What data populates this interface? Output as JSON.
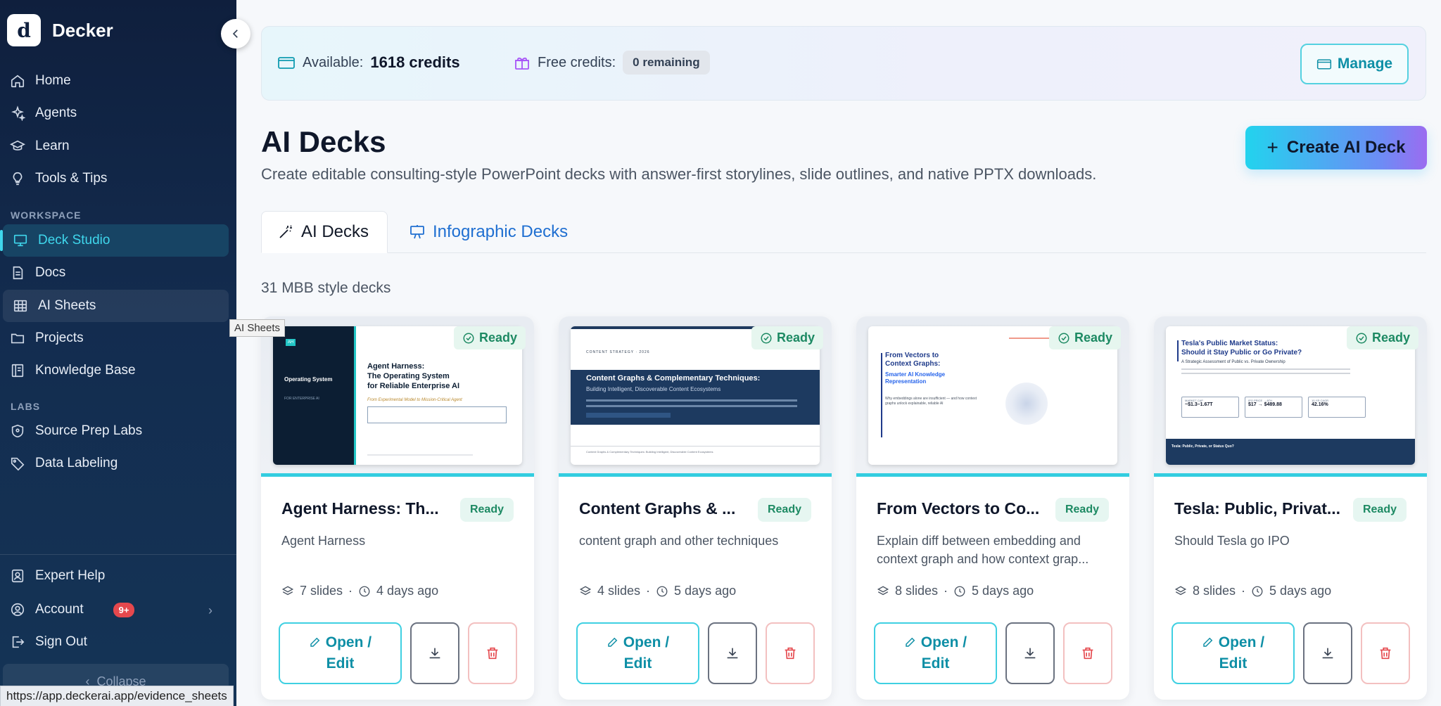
{
  "app": {
    "name": "Decker",
    "logo_letter": "d"
  },
  "sidebar": {
    "nav": [
      {
        "label": "Home",
        "icon": "home-icon"
      },
      {
        "label": "Agents",
        "icon": "sparkles-icon"
      },
      {
        "label": "Learn",
        "icon": "graduation-cap-icon"
      },
      {
        "label": "Tools & Tips",
        "icon": "lightbulb-icon"
      }
    ],
    "workspace_label": "WORKSPACE",
    "workspace": [
      {
        "label": "Deck Studio",
        "icon": "presentation-icon",
        "active": true
      },
      {
        "label": "Docs",
        "icon": "document-icon"
      },
      {
        "label": "AI Sheets",
        "icon": "table-icon",
        "hovered": true
      },
      {
        "label": "Projects",
        "icon": "folder-icon"
      },
      {
        "label": "Knowledge Base",
        "icon": "book-icon"
      }
    ],
    "labs_label": "LABS",
    "labs": [
      {
        "label": "Source Prep Labs",
        "icon": "shield-icon"
      },
      {
        "label": "Data Labeling",
        "icon": "tag-icon"
      }
    ],
    "bottom": [
      {
        "label": "Expert Help",
        "icon": "person-badge-icon"
      },
      {
        "label": "Account",
        "icon": "user-circle-icon",
        "badge": "9+"
      },
      {
        "label": "Sign Out",
        "icon": "sign-out-icon"
      }
    ],
    "collapse_label": "Collapse",
    "tooltip": "AI Sheets"
  },
  "status_url": "https://app.deckerai.app/evidence_sheets",
  "credits": {
    "available_label": "Available:",
    "available_value": "1618 credits",
    "free_label": "Free credits:",
    "free_value": "0 remaining",
    "manage_label": "Manage"
  },
  "page": {
    "title": "AI Decks",
    "subtitle": "Create editable consulting-style PowerPoint decks with answer-first storylines, slide outlines, and native PPTX downloads.",
    "create_label": "Create AI Deck",
    "tabs": [
      "AI Decks",
      "Infographic Decks"
    ],
    "count_label": "31 MBB style decks"
  },
  "cards": [
    {
      "title": "Agent Harness: Th...",
      "status": "Ready",
      "description": "Agent Harness",
      "slides": "7 slides",
      "time": "4 days ago",
      "open_label_1": "Open /",
      "open_label_2": "Edit",
      "thumb": {
        "heading": "Agent Harness:\nThe Operating System\nfor Reliable Enterprise AI",
        "sub": "From Experimental Model to Mission-Critical Agent",
        "side_title": "Operating System",
        "side_sub": "FOR ENTERPRISE AI",
        "side_tag": "AH"
      }
    },
    {
      "title": "Content Graphs & ...",
      "status": "Ready",
      "description": "content graph and other techniques",
      "slides": "4 slides",
      "time": "5 days ago",
      "open_label_1": "Open /",
      "open_label_2": "Edit",
      "thumb": {
        "kicker": "CONTENT STRATEGY · 2026",
        "heading": "Content Graphs & Complementary Techniques:",
        "sub": "Building Intelligent, Discoverable Content Ecosystems",
        "footer": "Content Graphs & Complementary Techniques: Building Intelligent, Discoverable Content Ecosystems"
      }
    },
    {
      "title": "From Vectors to Co...",
      "status": "Ready",
      "description": "Explain diff between embedding and context graph and how context grap...",
      "slides": "8 slides",
      "time": "5 days ago",
      "open_label_1": "Open /",
      "open_label_2": "Edit",
      "thumb": {
        "heading": "From Vectors to\nContext Graphs:",
        "sub": "Smarter AI Knowledge\nRepresentation",
        "body": "Why embeddings alone are insufficient — and how context graphs unlock explainable, reliable AI"
      }
    },
    {
      "title": "Tesla: Public, Privat...",
      "status": "Ready",
      "description": "Should Tesla go IPO",
      "slides": "8 slides",
      "time": "5 days ago",
      "open_label_1": "Open /",
      "open_label_2": "Edit",
      "thumb": {
        "heading": "Tesla's Public Market Status:\nShould it Stay Public or Go Private?",
        "sub": "A Strategic Assessment of Public vs. Private Ownership",
        "stat1_label": "MARKET CAP",
        "stat1": "~$1.3–1.67T",
        "stat2_label": "IPO PRICE → ATH",
        "stat2": "$17 → $489.88",
        "stat3_label": "10-YR CAGR",
        "stat3": "42.16%",
        "footer": "Tesla: Public, Private, or Status Quo?"
      }
    }
  ]
}
